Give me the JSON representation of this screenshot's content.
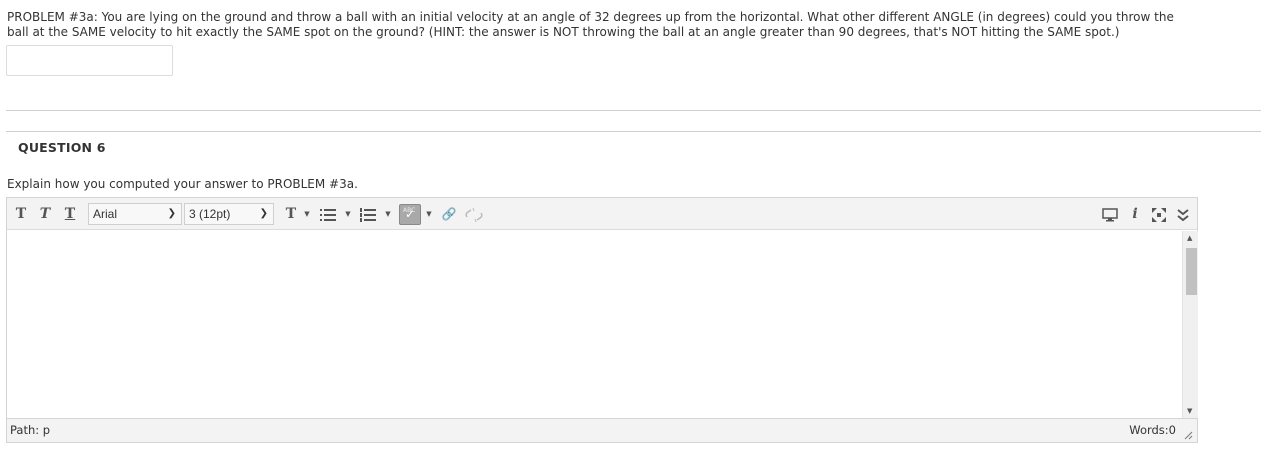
{
  "problem": {
    "line1": "PROBLEM #3a: You are lying on the ground and throw a ball with an initial velocity at an angle of 32 degrees up from the horizontal.  What other different ANGLE (in degrees) could you throw the",
    "line2": "ball at the SAME velocity to hit exactly the SAME spot on the ground?  (HINT: the answer is NOT throwing the ball at an angle greater than 90 degrees, that's NOT hitting the SAME spot.)",
    "answer_value": ""
  },
  "question": {
    "title": "QUESTION 6",
    "prompt": "Explain how you computed your answer to PROBLEM #3a."
  },
  "editor": {
    "toolbar": {
      "bold_label": "T",
      "italic_label": "T",
      "underline_label": "T",
      "font_family": "Arial",
      "font_size": "3 (12pt)",
      "text_color_label": "T",
      "spellcheck_label": "ABC",
      "icons": [
        "bold-icon",
        "italic-icon",
        "underline-icon",
        "text-color-icon",
        "bullet-list-icon",
        "numbered-list-icon",
        "spellcheck-icon",
        "link-icon",
        "unlink-icon",
        "preview-icon",
        "info-icon",
        "fullscreen-icon",
        "collapse-icon"
      ]
    },
    "content": "",
    "path_label": "Path: p",
    "word_count": "Words:0"
  }
}
